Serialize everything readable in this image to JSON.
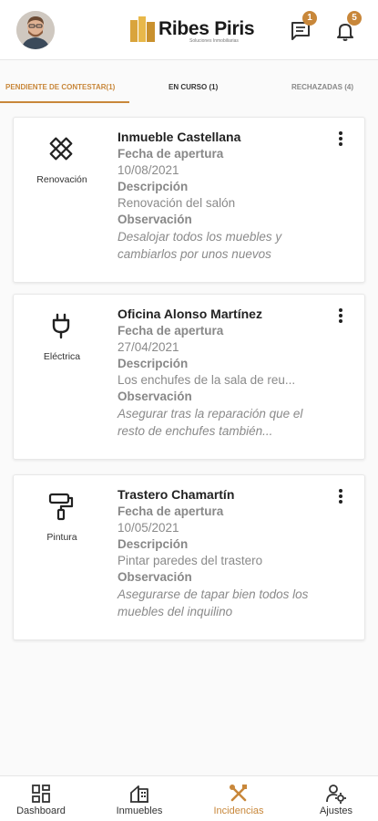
{
  "header": {
    "brand_name": "Ribes Piris",
    "brand_tagline": "Soluciones Inmobiliarias",
    "messages_count": "1",
    "notifications_count": "5",
    "accent_color": "#c8873a"
  },
  "tabs": [
    {
      "label": "PENDIENTE DE CONTESTAR(1)"
    },
    {
      "label": "EN CURSO (1)"
    },
    {
      "label": "RECHAZADAS (4)"
    }
  ],
  "cards": [
    {
      "category": "Renovación",
      "icon": "tools-icon",
      "title": "Inmueble Castellana",
      "date_label": "Fecha de apertura",
      "date": "10/08/2021",
      "desc_label": "Descripción",
      "desc": "Renovación del salón",
      "obs_label": "Observación",
      "obs": "Desalojar todos los muebles y cambiarlos por unos nuevos"
    },
    {
      "category": "Eléctrica",
      "icon": "plug-icon",
      "title": "Oficina Alonso Martínez",
      "date_label": "Fecha de apertura",
      "date": "27/04/2021",
      "desc_label": "Descripción",
      "desc": "Los enchufes de la sala de reu...",
      "obs_label": "Observación",
      "obs": "Asegurar tras la reparación que el resto de enchufes también..."
    },
    {
      "category": "Pintura",
      "icon": "paint-roller-icon",
      "title": "Trastero Chamartín",
      "date_label": "Fecha de apertura",
      "date": "10/05/2021",
      "desc_label": "Descripción",
      "desc": "Pintar paredes del trastero",
      "obs_label": "Observación",
      "obs": "Asegurarse de tapar bien todos los muebles del inquilino"
    }
  ],
  "bottom_nav": [
    {
      "label": "Dashboard",
      "icon": "dashboard-icon"
    },
    {
      "label": "Inmuebles",
      "icon": "building-icon"
    },
    {
      "label": "Incidencias",
      "icon": "tools-icon",
      "active": true
    },
    {
      "label": "Ajustes",
      "icon": "user-settings-icon"
    }
  ]
}
